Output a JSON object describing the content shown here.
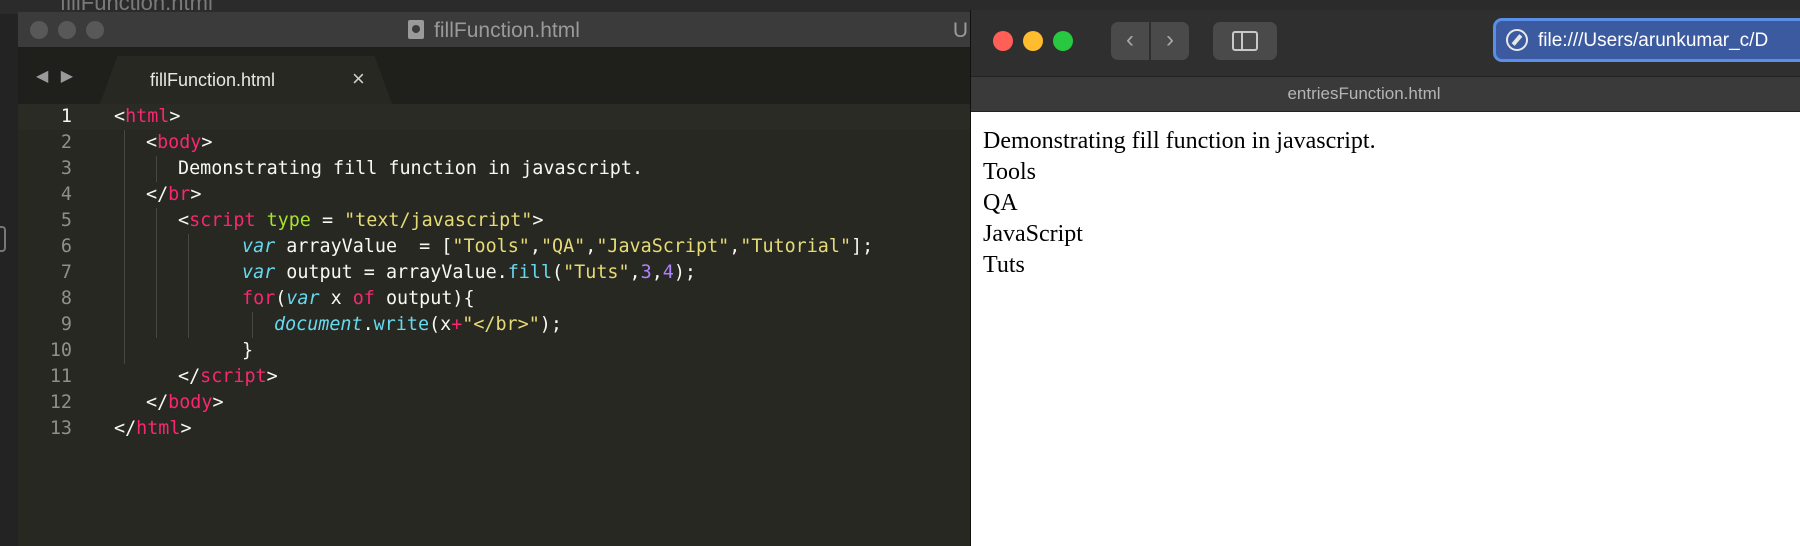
{
  "background": {
    "tab_label": "fillFunction.html"
  },
  "editor": {
    "window_title": "fillFunction.html",
    "title_tail": "U",
    "nav_arrows": "◀ ▶",
    "tab_label": "fillFunction.html",
    "tab_close": "×",
    "line_numbers": [
      "1",
      "2",
      "3",
      "4",
      "5",
      "6",
      "7",
      "8",
      "9",
      "10",
      "11",
      "12",
      "13"
    ],
    "lines": {
      "l1": {
        "lt": "<",
        "tag": "html",
        "gt": ">"
      },
      "l2": {
        "lt": "<",
        "tag": "body",
        "gt": ">"
      },
      "l3": {
        "text": "Demonstrating fill function in javascript."
      },
      "l4": {
        "lt": "</",
        "tag": "br",
        "gt": ">"
      },
      "l5": {
        "lt": "<",
        "tag": "script",
        "attr": "type",
        "eq": " = ",
        "val": "\"text/javascript\"",
        "gt": ">"
      },
      "l6": {
        "kw": "var",
        "name": " arrayValue  = [",
        "s1": "\"Tools\"",
        "c1": ",",
        "s2": "\"QA\"",
        "c2": ",",
        "s3": "\"JavaScript\"",
        "c3": ",",
        "s4": "\"Tutorial\"",
        "end": "];"
      },
      "l7": {
        "kw": "var",
        "name": " output = arrayValue.",
        "fn": "fill",
        "open": "(",
        "s1": "\"Tuts\"",
        "c1": ",",
        "n1": "3",
        "c2": ",",
        "n2": "4",
        "end": ");"
      },
      "l8": {
        "ctl": "for",
        "open": "(",
        "kw": "var",
        "mid": " x ",
        "of": "of",
        "end": " output){"
      },
      "l9": {
        "obj": "document",
        "dot": ".",
        "fn": "write",
        "open": "(x",
        "plus": "+",
        "s1": "\"</br>\"",
        "end": ");"
      },
      "l10": {
        "text": "}"
      },
      "l11": {
        "lt": "</",
        "tag": "script",
        "gt": ">"
      },
      "l12": {
        "lt": "</",
        "tag": "body",
        "gt": ">"
      },
      "l13": {
        "lt": "</",
        "tag": "html",
        "gt": ">"
      }
    },
    "colors": {
      "background": "#272822",
      "tag": "#f92672",
      "string": "#e6db74",
      "keyword": "#66d9ef",
      "number": "#ae81ff",
      "attribute": "#a6e22e"
    }
  },
  "browser": {
    "traffic_colors": [
      "#ff5f57",
      "#febc2e",
      "#28c840"
    ],
    "back_icon": "‹",
    "forward_icon": "›",
    "address_url": "file:///Users/arunkumar_c/D",
    "tab_title": "entriesFunction.html",
    "page_lines": [
      "Demonstrating fill function in javascript.",
      "Tools",
      "QA",
      "JavaScript",
      "Tuts"
    ]
  }
}
